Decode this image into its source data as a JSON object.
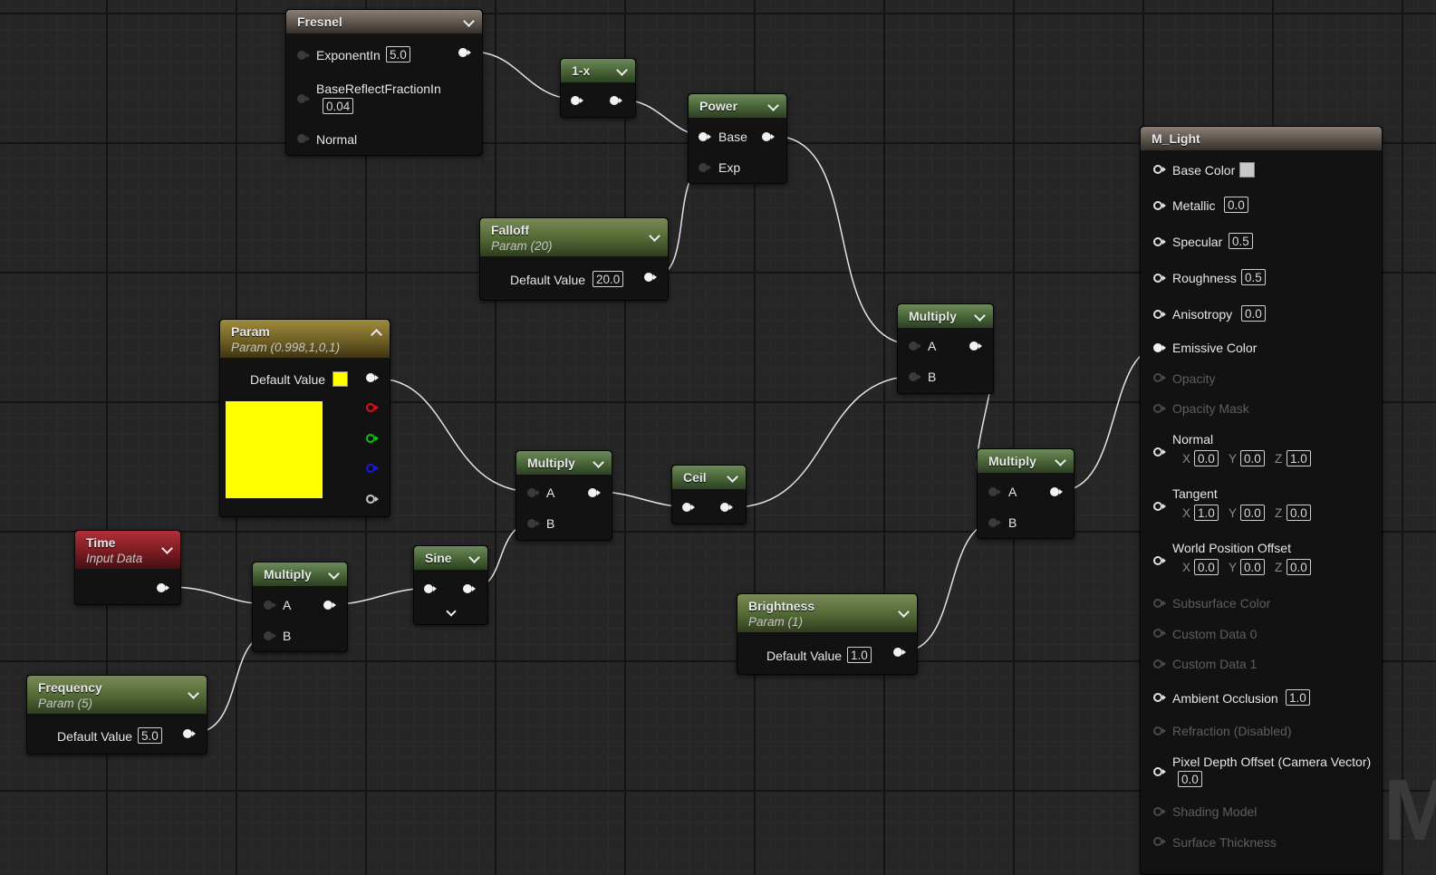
{
  "nodes": {
    "fresnel": {
      "title": "Fresnel",
      "exponent_label": "ExponentIn",
      "exponent_value": "5.0",
      "base_reflect_label": "BaseReflectFractionIn",
      "base_reflect_value": "0.04",
      "normal_label": "Normal"
    },
    "one_minus_x": {
      "title": "1-x"
    },
    "power": {
      "title": "Power",
      "base_label": "Base",
      "exp_label": "Exp"
    },
    "falloff": {
      "title": "Falloff",
      "subtitle": "Param (20)",
      "default_label": "Default Value",
      "default_value": "20.0"
    },
    "param_color": {
      "title": "Param",
      "subtitle": "Param (0.998,1,0,1)",
      "default_label": "Default Value",
      "color": "#ffff00"
    },
    "multiply_top": {
      "title": "Multiply",
      "a_label": "A",
      "b_label": "B"
    },
    "multiply_mid": {
      "title": "Multiply",
      "a_label": "A",
      "b_label": "B"
    },
    "multiply_right": {
      "title": "Multiply",
      "a_label": "A",
      "b_label": "B"
    },
    "multiply_left": {
      "title": "Multiply",
      "a_label": "A",
      "b_label": "B"
    },
    "ceil": {
      "title": "Ceil"
    },
    "sine": {
      "title": "Sine"
    },
    "time": {
      "title": "Time",
      "subtitle": "Input Data"
    },
    "frequency": {
      "title": "Frequency",
      "subtitle": "Param (5)",
      "default_label": "Default Value",
      "default_value": "5.0"
    },
    "brightness": {
      "title": "Brightness",
      "subtitle": "Param (1)",
      "default_label": "Default Value",
      "default_value": "1.0"
    }
  },
  "material": {
    "title": "M_Light",
    "base_color": {
      "label": "Base Color",
      "swatch": "#c8c8c8"
    },
    "metallic": {
      "label": "Metallic",
      "value": "0.0"
    },
    "specular": {
      "label": "Specular",
      "value": "0.5"
    },
    "roughness": {
      "label": "Roughness",
      "value": "0.5"
    },
    "anisotropy": {
      "label": "Anisotropy",
      "value": "0.0"
    },
    "emissive": {
      "label": "Emissive Color"
    },
    "opacity": {
      "label": "Opacity"
    },
    "opacity_mask": {
      "label": "Opacity Mask"
    },
    "normal": {
      "label": "Normal",
      "x": "0.0",
      "y": "0.0",
      "z": "1.0"
    },
    "tangent": {
      "label": "Tangent",
      "x": "1.0",
      "y": "0.0",
      "z": "0.0"
    },
    "wpo": {
      "label": "World Position Offset",
      "x": "0.0",
      "y": "0.0",
      "z": "0.0"
    },
    "subsurface": {
      "label": "Subsurface Color"
    },
    "custom0": {
      "label": "Custom Data 0"
    },
    "custom1": {
      "label": "Custom Data 1"
    },
    "ao": {
      "label": "Ambient Occlusion",
      "value": "1.0"
    },
    "refraction": {
      "label": "Refraction (Disabled)"
    },
    "pdo": {
      "label": "Pixel Depth Offset (Camera Vector)",
      "value": "0.0"
    },
    "shading_model": {
      "label": "Shading Model"
    },
    "surface_thickness": {
      "label": "Surface Thickness"
    },
    "axis": {
      "x": "X",
      "y": "Y",
      "z": "Z"
    }
  },
  "watermark": "M"
}
